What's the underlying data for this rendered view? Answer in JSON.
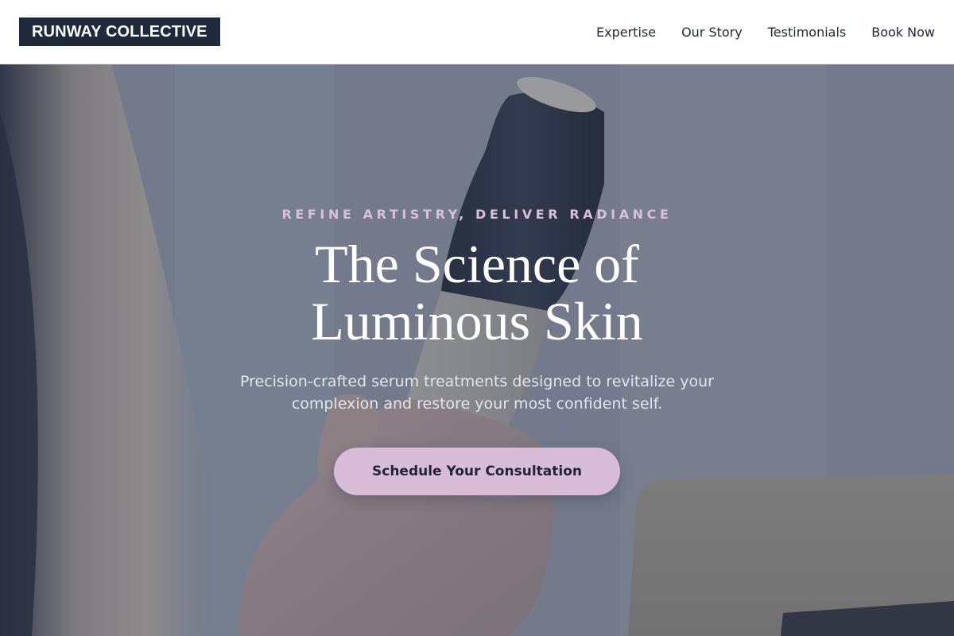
{
  "header": {
    "logo": "RUNWAY COLLECTIVE",
    "nav": [
      {
        "label": "Expertise"
      },
      {
        "label": "Our Story"
      },
      {
        "label": "Testimonials"
      },
      {
        "label": "Book Now"
      }
    ]
  },
  "hero": {
    "eyebrow": "REFINE ARTISTRY, DELIVER RADIANCE",
    "title_line1": "The Science of",
    "title_line2": "Luminous Skin",
    "subtitle_line1": "Precision-crafted serum treatments designed to revitalize your",
    "subtitle_line2": "complexion and restore your most confident self.",
    "cta_label": "Schedule Your Consultation",
    "background_image": "hand-holding-skincare-device-photo"
  },
  "colors": {
    "logo_bg": "#1e293b",
    "accent": "#d9bdd8",
    "eyebrow": "#dcbfd9",
    "nav_text": "#1f2937"
  }
}
